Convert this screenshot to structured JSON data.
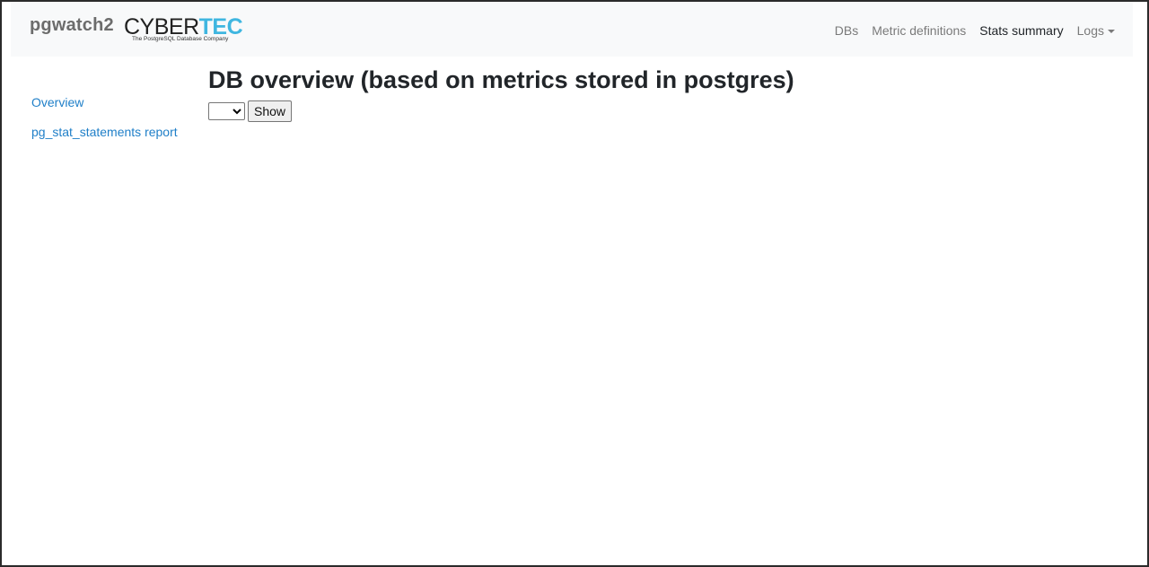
{
  "navbar": {
    "brand": "pgwatch2",
    "logo": {
      "word_part1": "CYBER",
      "word_part2": "TEC",
      "tagline": "The PostgreSQL Database Company",
      "accent_color": "#3fb6e0"
    },
    "links": [
      {
        "label": "DBs",
        "active": false
      },
      {
        "label": "Metric definitions",
        "active": false
      },
      {
        "label": "Stats summary",
        "active": true
      },
      {
        "label": "Logs",
        "active": false,
        "dropdown": true
      }
    ]
  },
  "sidebar": {
    "items": [
      {
        "label": "Overview"
      },
      {
        "label": "pg_stat_statements report"
      }
    ],
    "link_color": "#1f7fc8"
  },
  "main": {
    "title": "DB overview (based on metrics stored in postgres)",
    "db_select_value": "",
    "show_button": "Show"
  }
}
